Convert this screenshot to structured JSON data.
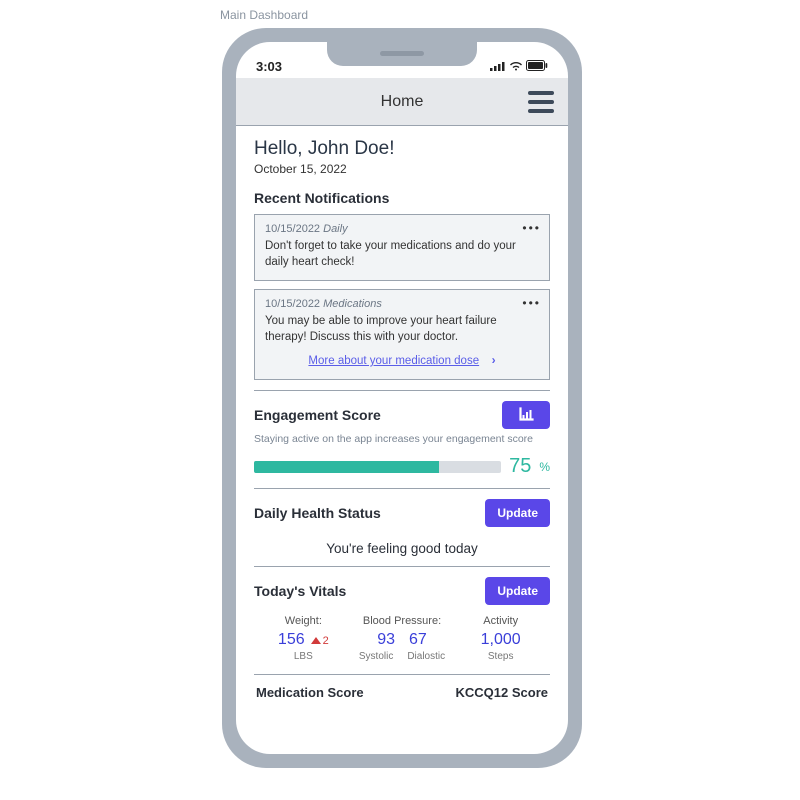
{
  "caption": "Main Dashboard",
  "status_bar": {
    "time": "3:03"
  },
  "header": {
    "title": "Home"
  },
  "greeting": "Hello, John Doe!",
  "date": "October 15, 2022",
  "notifications": {
    "title": "Recent Notifications",
    "items": [
      {
        "date": "10/15/2022",
        "category": "Daily",
        "text": "Don't forget to take your medications and do your daily heart check!"
      },
      {
        "date": "10/15/2022",
        "category": "Medications",
        "text": "You may be able to improve your heart failure therapy! Discuss this with your doctor.",
        "link_label": "More about your medication dose"
      }
    ]
  },
  "engagement": {
    "title": "Engagement Score",
    "subtext": "Staying active on the app increases your engagement score",
    "value": 75,
    "percent_symbol": "%"
  },
  "daily_status": {
    "title": "Daily Health Status",
    "button": "Update",
    "text": "You're feeling good today"
  },
  "vitals": {
    "title": "Today's Vitals",
    "button": "Update",
    "weight": {
      "label": "Weight:",
      "value": "156",
      "trend_delta": "2",
      "unit": "LBS"
    },
    "bp": {
      "label": "Blood Pressure:",
      "systolic": "93",
      "diastolic": "67",
      "systolic_label": "Systolic",
      "diastolic_label": "Dialostic"
    },
    "activity": {
      "label": "Activity",
      "value": "1,000",
      "unit": "Steps"
    }
  },
  "bottom_peek": {
    "left": "Medication Score",
    "right": "KCCQ12 Score"
  }
}
